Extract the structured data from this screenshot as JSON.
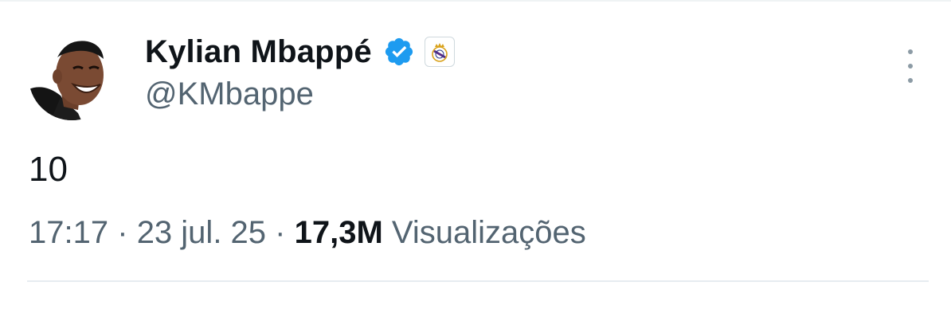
{
  "tweet": {
    "author": {
      "display_name": "Kylian Mbappé",
      "handle": "@KMbappe",
      "verified_icon": "verified-checkmark-icon",
      "affiliate_badge_icon": "real-madrid-crest-icon"
    },
    "text": "10",
    "time": "17:17",
    "separator": "·",
    "date": "23 jul. 25",
    "views_count": "17,3M",
    "views_label": "Visualizações",
    "more_icon": "more-vertical-icon"
  },
  "colors": {
    "text_primary": "#0f1419",
    "text_secondary": "#536471",
    "verified_blue": "#1d9bf0",
    "divider": "#e6ecf0"
  }
}
